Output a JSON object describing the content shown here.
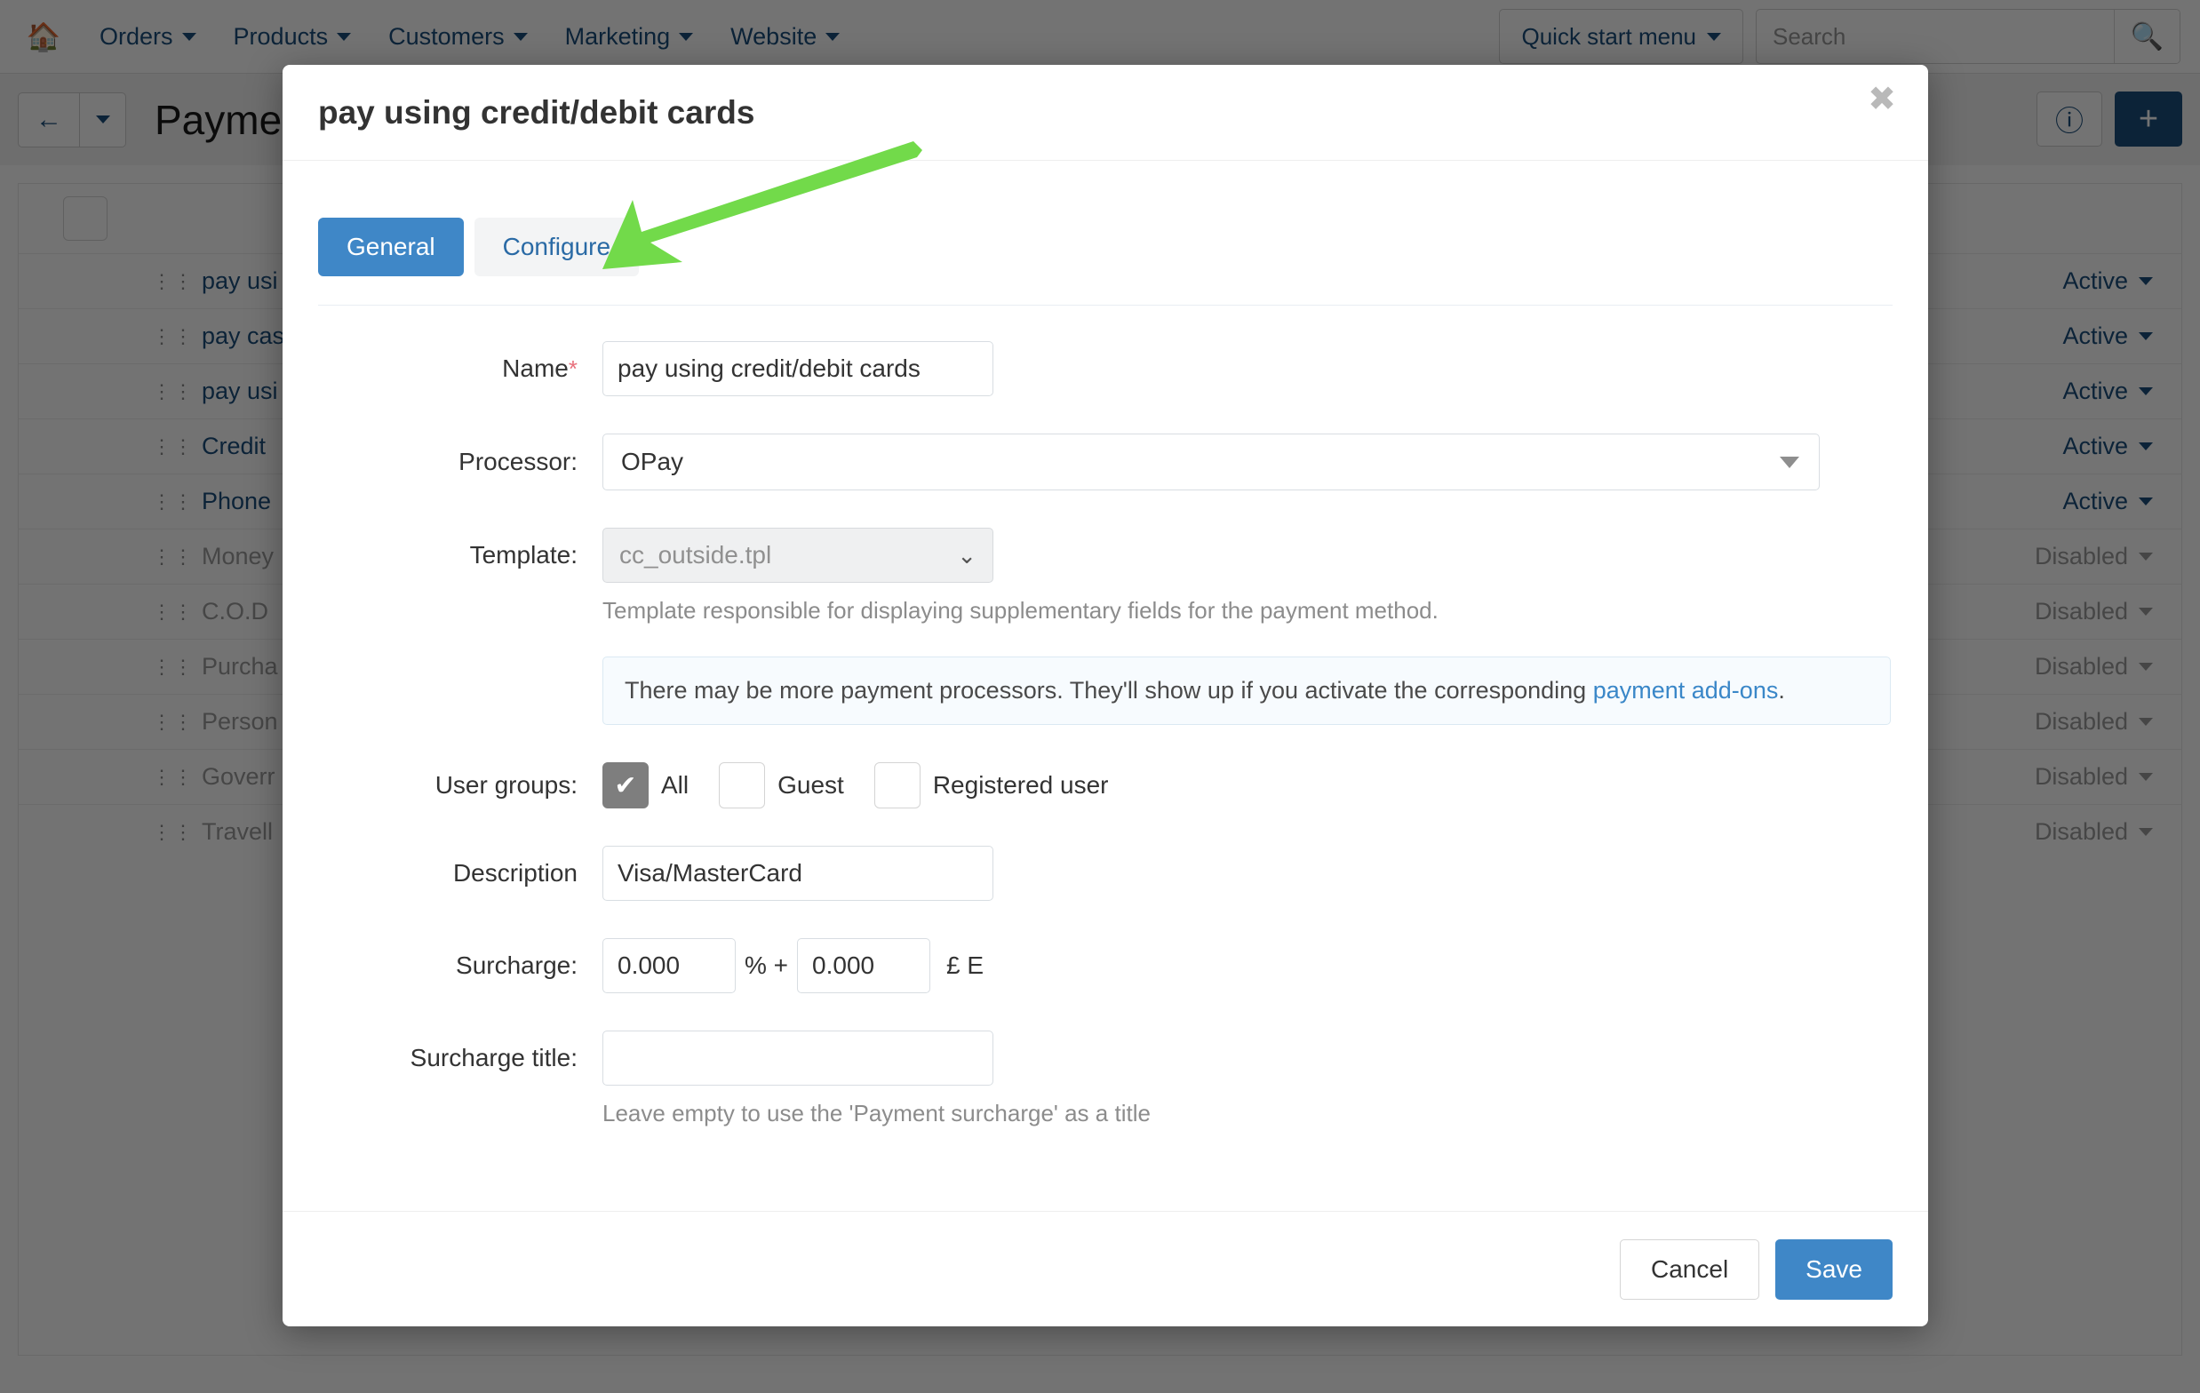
{
  "topnav": {
    "home_icon": "home-icon",
    "items": [
      {
        "label": "Orders"
      },
      {
        "label": "Products"
      },
      {
        "label": "Customers"
      },
      {
        "label": "Marketing"
      },
      {
        "label": "Website"
      }
    ],
    "quick_start_label": "Quick start menu",
    "search_placeholder": "Search",
    "search_value": "",
    "search_icon": "search-icon"
  },
  "subheader": {
    "back_icon": "arrow-left-icon",
    "page_title": "Payme",
    "help_icon": "question-circle-icon",
    "add_icon": "plus-icon"
  },
  "list": {
    "rows": [
      {
        "name": "pay usi",
        "status": "Active",
        "dim": false
      },
      {
        "name": "pay cas",
        "status": "Active",
        "dim": false
      },
      {
        "name": "pay usi",
        "status": "Active",
        "dim": false
      },
      {
        "name": "Credit",
        "status": "Active",
        "dim": false
      },
      {
        "name": "Phone",
        "status": "Active",
        "dim": false
      },
      {
        "name": "Money",
        "status": "Disabled",
        "dim": true
      },
      {
        "name": "C.O.D",
        "status": "Disabled",
        "dim": true
      },
      {
        "name": "Purcha",
        "status": "Disabled",
        "dim": true
      },
      {
        "name": "Person",
        "status": "Disabled",
        "dim": true
      },
      {
        "name": "Goverr",
        "status": "Disabled",
        "dim": true
      },
      {
        "name": "Travell",
        "status": "Disabled",
        "dim": true
      }
    ]
  },
  "modal": {
    "title": "pay using credit/debit cards",
    "close_icon": "close-icon",
    "tabs": [
      {
        "label": "General",
        "active": true
      },
      {
        "label": "Configure",
        "active": false
      }
    ],
    "fields": {
      "name_label": "Name",
      "name_required": "*",
      "name_value": "pay using credit/debit cards",
      "processor_label": "Processor:",
      "processor_value": "OPay",
      "template_label": "Template:",
      "template_value": "cc_outside.tpl",
      "template_help": "Template responsible for displaying supplementary fields for the payment method.",
      "alert_text_before": "There may be more payment processors. They'll show up if you activate the corresponding ",
      "alert_link": "payment add-ons",
      "alert_text_after": ".",
      "usergroups_label": "User groups:",
      "usergroups": [
        {
          "label": "All",
          "checked": true
        },
        {
          "label": "Guest",
          "checked": false
        },
        {
          "label": "Registered user",
          "checked": false
        }
      ],
      "description_label": "Description",
      "description_value": "Visa/MasterCard",
      "surcharge_label": "Surcharge:",
      "surcharge_percent_value": "0.000",
      "surcharge_percent_unit": "% +",
      "surcharge_absolute_value": "0.000",
      "surcharge_currency": "£ E",
      "surcharge_title_label": "Surcharge title:",
      "surcharge_title_value": "",
      "surcharge_title_help": "Leave empty to use the 'Payment surcharge' as a title"
    },
    "footer": {
      "cancel_label": "Cancel",
      "save_label": "Save"
    }
  },
  "annotation": {
    "arrow_color": "#72DA4A",
    "arrow_name": "green-pointer-arrow"
  },
  "colors": {
    "primary": "#3f87c7",
    "nav_link": "#1c4f7c",
    "required": "#e8707c",
    "link": "#3a87c8"
  }
}
